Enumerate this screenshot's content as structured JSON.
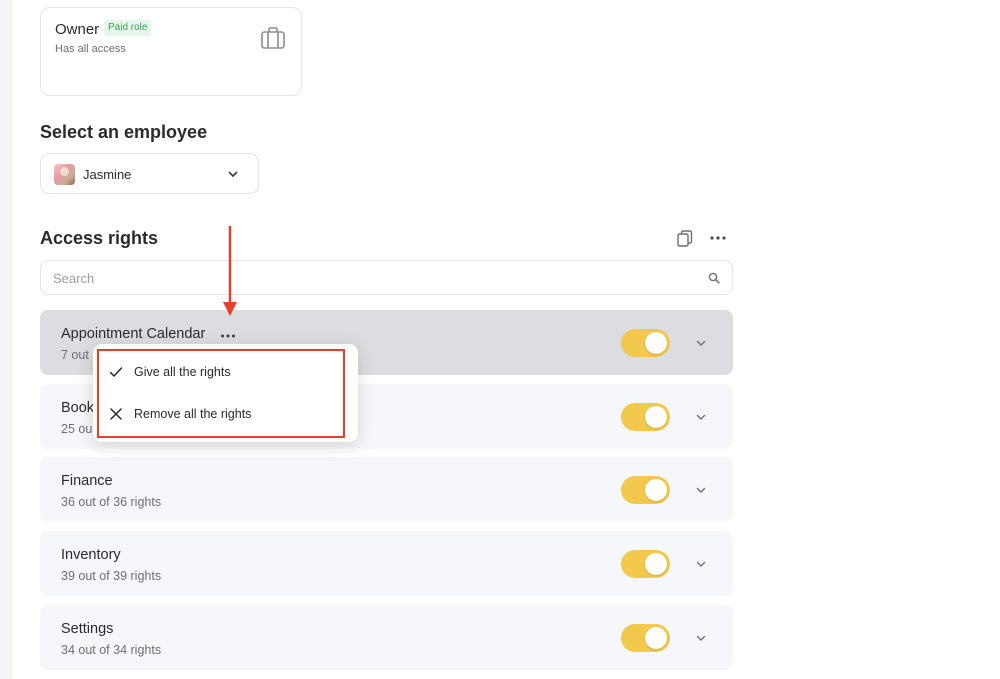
{
  "role_card": {
    "title": "Owner",
    "badge": "Paid role",
    "description": "Has all access",
    "icon": "briefcase-icon"
  },
  "employee_section": {
    "title": "Select an employee",
    "selected": "Jasmine"
  },
  "access_section": {
    "title": "Access rights",
    "search_placeholder": "Search"
  },
  "modules": [
    {
      "title": "Appointment Calendar",
      "subtitle": "7 out",
      "enabled": true
    },
    {
      "title": "Book",
      "subtitle": "25 ou",
      "enabled": true
    },
    {
      "title": "Finance",
      "subtitle": "36 out of 36 rights",
      "enabled": true
    },
    {
      "title": "Inventory",
      "subtitle": "39 out of 39 rights",
      "enabled": true
    },
    {
      "title": "Settings",
      "subtitle": "34 out of 34 rights",
      "enabled": true
    }
  ],
  "dropdown": {
    "items": [
      {
        "label": "Give all the rights",
        "icon": "check-icon"
      },
      {
        "label": "Remove all the rights",
        "icon": "close-icon"
      }
    ]
  },
  "colors": {
    "toggle_on": "#f2c94c",
    "annotation": "#e2412c",
    "badge_text": "#3aa35a",
    "badge_bg": "#e7f6ec"
  }
}
